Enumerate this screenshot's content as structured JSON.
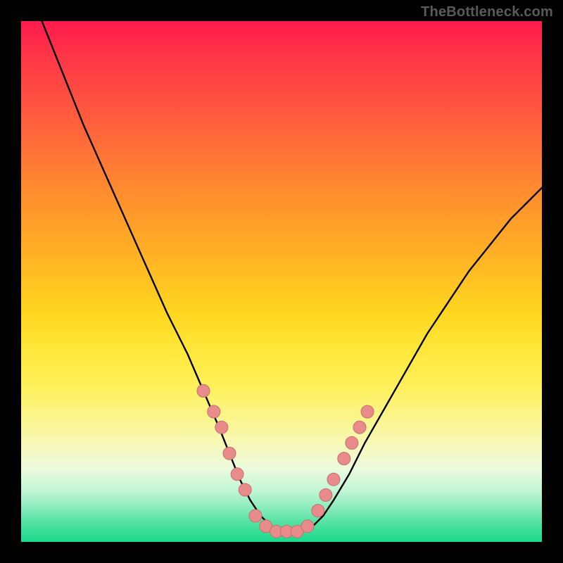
{
  "watermark": "TheBottleneck.com",
  "colors": {
    "background": "#000000",
    "curve": "#000000",
    "marker_fill": "#e98b8b",
    "marker_stroke": "#c46f6f",
    "gradient_top": "#ff1a4d",
    "gradient_bottom": "#18da8b"
  },
  "chart_data": {
    "type": "line",
    "title": "",
    "xlabel": "",
    "ylabel": "",
    "xlim": [
      0,
      100
    ],
    "ylim": [
      0,
      100
    ],
    "note": "No numeric axis ticks are visible; x/y are normalized 0–100. Lower y = closer to optimal (green band at bottom).",
    "series": [
      {
        "name": "bottleneck-curve",
        "x": [
          4,
          8,
          12,
          16,
          20,
          24,
          28,
          32,
          35,
          38,
          40,
          42,
          44,
          46,
          48,
          50,
          52,
          54,
          56,
          58,
          60,
          63,
          66,
          70,
          74,
          78,
          82,
          86,
          90,
          94,
          98,
          100
        ],
        "y": [
          100,
          90,
          80,
          71,
          62,
          53,
          44,
          36,
          29,
          22,
          17,
          12,
          8,
          5,
          3,
          2,
          2,
          2,
          3,
          5,
          8,
          13,
          19,
          26,
          33,
          40,
          46,
          52,
          57,
          62,
          66,
          68
        ]
      }
    ],
    "markers": {
      "name": "highlighted-points",
      "x": [
        35,
        37,
        38.5,
        40,
        41.5,
        43,
        45,
        47,
        49,
        51,
        53,
        55,
        57,
        58.5,
        60,
        62,
        63.5,
        65,
        66.5
      ],
      "y": [
        29,
        25,
        22,
        17,
        13,
        10,
        5,
        3,
        2,
        2,
        2,
        3,
        6,
        9,
        12,
        16,
        19,
        22,
        25
      ]
    }
  }
}
